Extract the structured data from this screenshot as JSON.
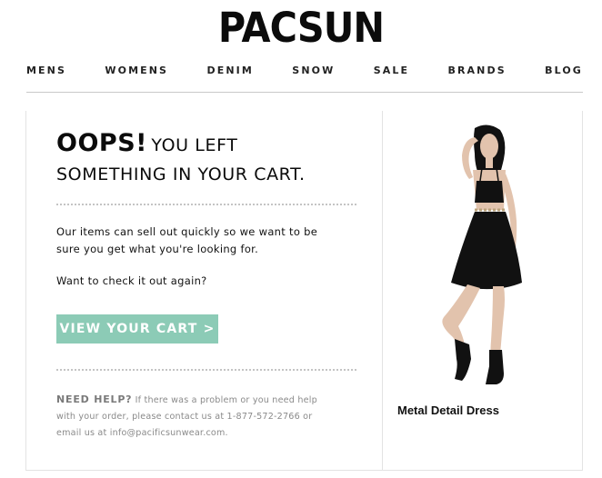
{
  "brand": {
    "logo_text": "PACSUN"
  },
  "nav": {
    "items": [
      "MENS",
      "WOMENS",
      "DENIM",
      "SNOW",
      "SALE",
      "BRANDS",
      "BLOG"
    ]
  },
  "message": {
    "headline_bold": "OOPS!",
    "headline_rest_line1": "YOU LEFT",
    "headline_rest_line2": "SOMETHING IN YOUR CART.",
    "body_line1": "Our items can sell out quickly so we want to be",
    "body_line2": "sure you get what you're looking for.",
    "question": "Want to check it out again?",
    "cta_label": "VIEW YOUR CART >"
  },
  "help": {
    "title": "NEED HELP?",
    "line1": "If there was a problem or you need help",
    "line2": "with your order, please contact us at 1-877-572-2766 or",
    "line3": "email us at info@pacificsunwear.com."
  },
  "product": {
    "name": "Metal Detail Dress",
    "image_icon": "dress-model-image"
  },
  "colors": {
    "cta_background": "#8ccbb6",
    "cta_text": "#ffffff",
    "help_text": "#8a8a8a",
    "divider": "#e3e3e3"
  }
}
